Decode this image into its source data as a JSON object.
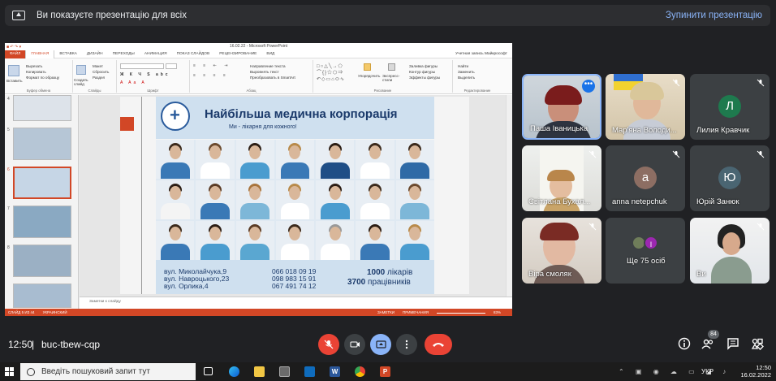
{
  "banner": {
    "text": "Ви показуєте презентацію для всіх",
    "stop_label": "Зупинити презентацію"
  },
  "ppt": {
    "title": "16.02.22 - Microsoft PowerPoint",
    "tabs": [
      "ФАЙЛ",
      "ГЛАВНАЯ",
      "ВСТАВКА",
      "ДИЗАЙН",
      "ПЕРЕХОДЫ",
      "АНИМАЦИЯ",
      "ПОКАЗ СЛАЙДОВ",
      "РЕЦЕНЗИРОВАНИЕ",
      "ВИД"
    ],
    "user": "Учетная запись Майкрософт",
    "ribbon": {
      "clipboard": {
        "paste": "Вставить",
        "lines": [
          "Вырезать",
          "Копировать",
          "Формат по образцу"
        ],
        "name": "Буфер обмена"
      },
      "slides": {
        "create": "Создать слайд",
        "lines": [
          "Макет",
          "Сбросить",
          "Раздел"
        ],
        "name": "Слайды"
      },
      "font": {
        "name": "Шрифт"
      },
      "paragraph": {
        "lines": [
          "Направление текста",
          "Выровнять текст",
          "Преобразовать в SmartArt"
        ],
        "name": "Абзац"
      },
      "drawing": {
        "arrange": "Упорядочить",
        "styles": "Экспресс-стили",
        "lines": [
          "Заливка фигуры",
          "Контур фигуры",
          "Эффекты фигуры"
        ],
        "name": "Рисование"
      },
      "editing": {
        "lines": [
          "Найти",
          "Заменить",
          "Выделить"
        ],
        "name": "Редактирование"
      }
    },
    "thumb_numbers": [
      "4",
      "5",
      "6",
      "7",
      "8"
    ],
    "notes_placeholder": "Заметки к слайду",
    "status": {
      "slide": "СЛАЙД 5 ИЗ 44",
      "lang": "УКРАИНСКИЙ",
      "notes": "ЗАМЕТКИ",
      "comments": "ПРИМЕЧАНИЯ",
      "zoom": "83%"
    }
  },
  "slide": {
    "headline": "Найбільша медична корпорація",
    "tagline": "Ми - лікарня для кожного!",
    "addresses": [
      "вул. Миколайчука,9",
      "вул. Навроцького,23",
      "вул. Орлика,4"
    ],
    "phones": [
      "066 018 09 19",
      "098 983 15 91",
      "067 491 74 12"
    ],
    "stat1_value": "1000",
    "stat1_label": "лікарів",
    "stat2_value": "3700",
    "stat2_label": "працівників"
  },
  "participants": [
    {
      "name": "Паша Іваницька",
      "type": "video"
    },
    {
      "name": "Мар'яна Володи...",
      "type": "video"
    },
    {
      "name": "Лилия Кравчик",
      "initial": "Л",
      "color": "#1e7a4e"
    },
    {
      "name": "Світлана Бухал...",
      "type": "video"
    },
    {
      "name": "anna netepchuk",
      "initial": "a",
      "color": "#8d6e63"
    },
    {
      "name": "Юрій Занюк",
      "initial": "Ю",
      "color": "#4a6572"
    },
    {
      "name": "Віра смоляк",
      "type": "video"
    },
    {
      "name": "Ще 75 осіб",
      "initial": "I",
      "color": "#9c27b0"
    },
    {
      "name": "Ви",
      "type": "video"
    }
  ],
  "bottombar": {
    "time": "12:50",
    "separator": "|",
    "code": "buc-tbew-cqp",
    "people_count": "84"
  },
  "taskbar": {
    "search_placeholder": "Введіть пошуковий запит тут",
    "lang": "УКР",
    "clock_time": "12:50",
    "clock_date": "16.02.2022"
  }
}
